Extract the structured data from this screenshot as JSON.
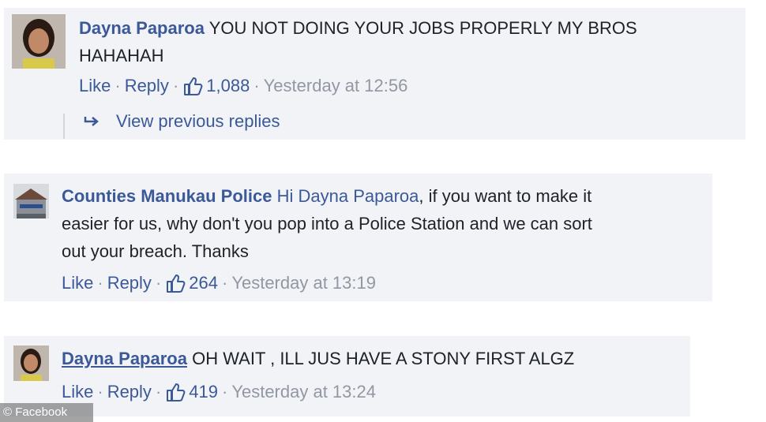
{
  "comments": [
    {
      "author": "Dayna Paparoa",
      "text": "YOU NOT DOING YOUR JOBS PROPERLY MY BROS",
      "text_line2": "HAHAHAH",
      "like_label": "Like",
      "reply_label": "Reply",
      "likes": "1,088",
      "timestamp": "Yesterday at 12:56",
      "view_replies": "View previous replies"
    },
    {
      "author": "Counties Manukau Police",
      "mention": "Hi Dayna Paparoa",
      "text_line1_rest": ", if you want to make it",
      "text_line2": "easier for us, why don't you pop into a Police Station and we can sort",
      "text_line3": "out your breach. Thanks",
      "like_label": "Like",
      "reply_label": "Reply",
      "likes": "264",
      "timestamp": "Yesterday at 13:19"
    },
    {
      "author": "Dayna Paparoa",
      "text": "OH WAIT , ILL JUS HAVE A STONY FIRST ALGZ",
      "like_label": "Like",
      "reply_label": "Reply",
      "likes": "419",
      "timestamp": "Yesterday at 13:24"
    }
  ],
  "separator": "·",
  "watermark": "© Facebook",
  "colors": {
    "link": "#3b5998",
    "meta": "#9197a3",
    "comment_bg": "#f2f3f6"
  }
}
